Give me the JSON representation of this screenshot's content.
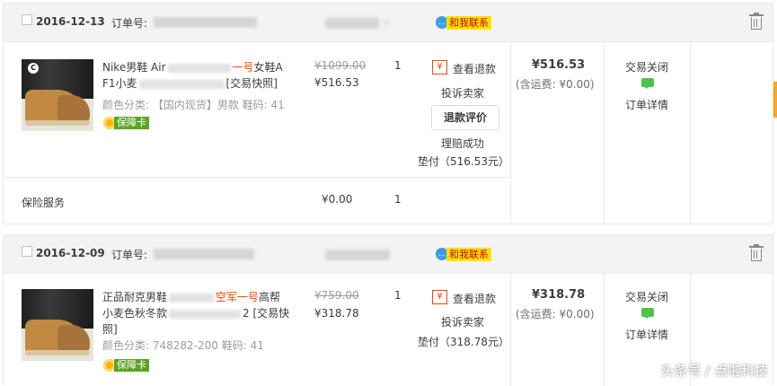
{
  "orders": [
    {
      "date": "2016-12-13",
      "order_label": "订单号:",
      "contact_label": "和我联系",
      "product": {
        "title_a": "Nike男鞋 Air",
        "title_red": "一号",
        "title_b": "女鞋A",
        "title_line2_a": "F1小麦",
        "title_line2_b": "[交易快照]",
        "attrs": "颜色分类: 【国内现货】男款   鞋码: 41",
        "card": "保障卡",
        "old_price": "¥1099.00",
        "price": "¥516.53",
        "qty": "1"
      },
      "actions": {
        "view_refund": "查看退款",
        "complain": "投诉卖家",
        "review_button": "退款评价",
        "claim": "理赔成功",
        "advance": "垫付（516.53元）"
      },
      "total": "¥516.53",
      "shipping": "(含运费: ¥0.00)",
      "status": "交易关闭",
      "detail": "订单详情",
      "insurance": {
        "label": "保险服务",
        "price": "¥0.00",
        "qty": "1"
      }
    },
    {
      "date": "2016-12-09",
      "order_label": "订单号:",
      "contact_label": "和我联系",
      "product": {
        "title_a": "正品耐克男鞋",
        "title_red": "空军一号",
        "title_b": "高帮",
        "title_line2_a": "小麦色秋冬款",
        "title_line2_b": "2 [交易快",
        "title_line3": "照]",
        "attrs": "颜色分类: 748282-200   鞋码: 41",
        "card": "保障卡",
        "old_price": "¥759.00",
        "price": "¥318.78",
        "qty": "1"
      },
      "actions": {
        "view_refund": "查看退款",
        "complain": "投诉卖家",
        "advance": "垫付（318.78元）"
      },
      "total": "¥318.78",
      "shipping": "(含运费: ¥0.00)",
      "status": "交易关闭",
      "detail": "订单详情"
    }
  ],
  "watermark": "头条号 / 点啦科技",
  "icons": {
    "trash": "trash-icon",
    "chat": "chat-icon",
    "refund": "yen-icon",
    "card": "shield-icon"
  },
  "colors": {
    "accent_red": "#f40",
    "contact_yellow": "#ffe100",
    "card_green": "#5ba326",
    "chat_green": "#4fc24c"
  }
}
